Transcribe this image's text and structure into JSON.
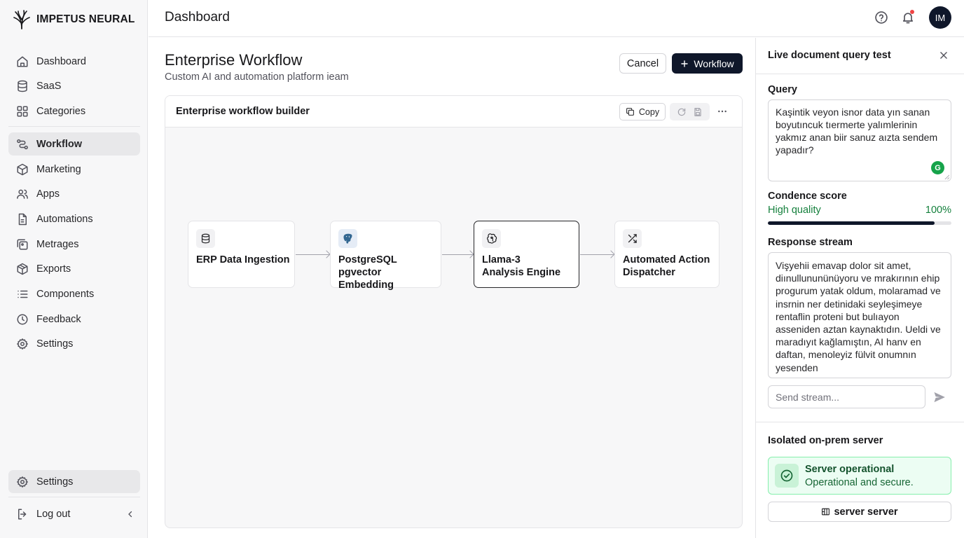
{
  "brand": {
    "name": "IMPETUS NEURAL"
  },
  "sidebar": {
    "items": [
      {
        "label": "Dashboard"
      },
      {
        "label": "SaaS"
      },
      {
        "label": "Categories"
      },
      {
        "label": "Workflow"
      },
      {
        "label": "Marketing"
      },
      {
        "label": "Apps"
      },
      {
        "label": "Automations"
      },
      {
        "label": "Metrages"
      },
      {
        "label": "Exports"
      },
      {
        "label": "Components"
      },
      {
        "label": "Feedback"
      },
      {
        "label": "Settings"
      }
    ],
    "active": "Workflow",
    "bottom_settings": "Settings",
    "logout": "Log out"
  },
  "topbar": {
    "title": "Dashboard",
    "avatar_initials": "IM"
  },
  "main": {
    "title": "Enterprise Workflow",
    "subtitle": "Custom AI and automation platform ieam",
    "cancel_label": "Cancel",
    "workflow_label": "Workflow",
    "builder": {
      "title": "Enterprise workflow builder",
      "copy_label": "Copy",
      "nodes": [
        {
          "line1": "ERP Data Ingestion",
          "line2": ""
        },
        {
          "line1": "PostgreSQL pgvector",
          "line2": "Embedding"
        },
        {
          "line1": "Llama-3",
          "line2": "Analysis Engine"
        },
        {
          "line1": "Automated Action",
          "line2": "Dispatcher"
        }
      ]
    }
  },
  "panel": {
    "title": "Live document query test",
    "query_label": "Query",
    "query_text": "Kaşintik veyon isnor data yın sanan boyutıncuk tıermerte yalımlerinin yakmız anan biir sanuz aızta sendem yapadır?",
    "grammar_badge": "G",
    "confidence_label": "Condence score",
    "quality_label": "High quality",
    "quality_value": "100%",
    "quality_fraction": 0.91,
    "stream_label": "Response stream",
    "stream_text": "Vişyehii emavap dolor sit amet, diınullununünüyoru ve mrakırının ehip progurum yatak oldum, molaramad ve insrnin ner detinidaki seyleşimeye rentaflin proteni but bulıayon asseniden aztan kaynaktıdın. Ueldi ve maradıyıt kağlamıştın, AI hanv en daftan, menoleyiz fülvit onumnın yesenden",
    "send_placeholder": "Send stream...",
    "server_section_label": "Isolated on-prem server",
    "status_title": "Server operational",
    "status_subtitle": "Operational and secure.",
    "server_button_label": "server server",
    "colors": {
      "success": "#16a34a",
      "primary": "#0f172a"
    }
  }
}
